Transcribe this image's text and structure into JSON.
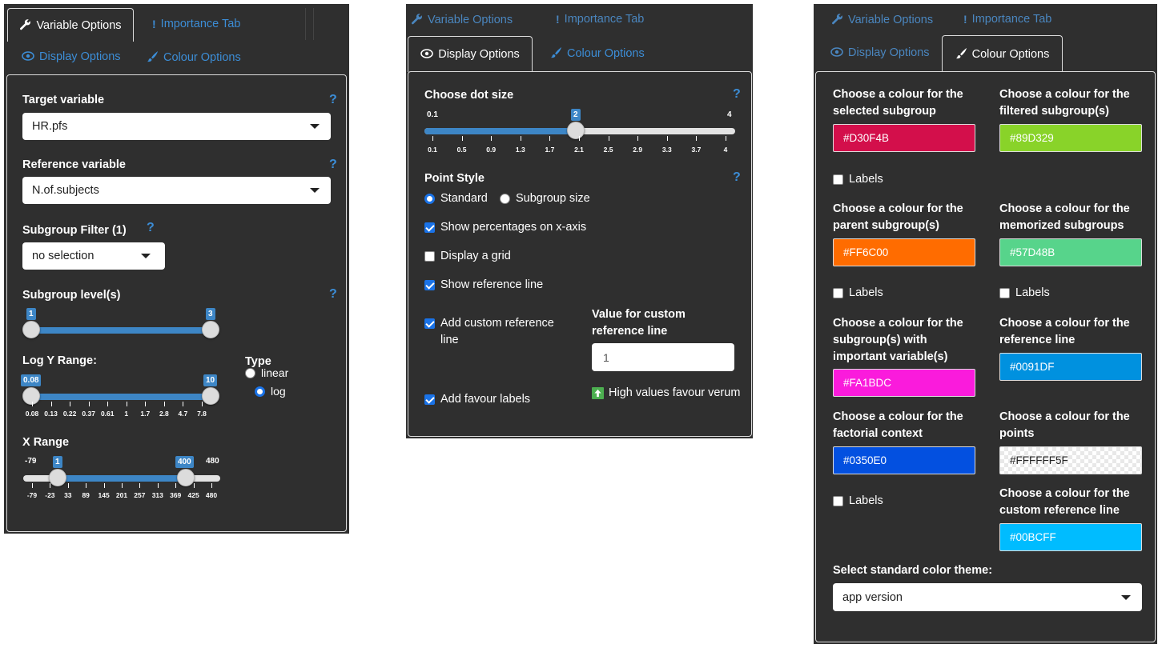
{
  "tabs": {
    "variable_options": "Variable Options",
    "importance_tab": "Importance Tab",
    "display_options": "Display Options",
    "colour_options": "Colour Options"
  },
  "panel1": {
    "target_variable": {
      "label": "Target variable",
      "value": "HR.pfs"
    },
    "reference_variable": {
      "label": "Reference variable",
      "value": "N.of.subjects"
    },
    "subgroup_filter": {
      "label": "Subgroup Filter (1)",
      "value": "no selection"
    },
    "subgroup_levels": {
      "label": "Subgroup level(s)",
      "min": "1",
      "max": "3"
    },
    "log_y_range": {
      "label": "Log Y Range:",
      "min": "0.08",
      "max": "10",
      "ticks": [
        "0.08",
        "0.13",
        "0.22",
        "0.37",
        "0.61",
        "1",
        "1.7",
        "2.8",
        "4.7",
        "7.8"
      ]
    },
    "type": {
      "label": "Type",
      "options": [
        "linear",
        "log"
      ],
      "selected": "log"
    },
    "x_range": {
      "label": "X Range",
      "edge_min": "-79",
      "edge_max": "480",
      "min": "1",
      "max": "400",
      "ticks": [
        "-79",
        "-23",
        "33",
        "89",
        "145",
        "201",
        "257",
        "313",
        "369",
        "425",
        "480"
      ]
    },
    "help": "?"
  },
  "panel2": {
    "dot_size": {
      "label": "Choose dot size",
      "edge_min": "0.1",
      "edge_max": "4",
      "value": "2",
      "ticks": [
        "0.1",
        "0.5",
        "0.9",
        "1.3",
        "1.7",
        "2.1",
        "2.5",
        "2.9",
        "3.3",
        "3.7",
        "4"
      ]
    },
    "point_style": {
      "label": "Point Style",
      "options": [
        "Standard",
        "Subgroup size"
      ],
      "selected": "Standard"
    },
    "show_percentages": "Show percentages on x-axis",
    "display_grid": "Display a grid",
    "show_reference_line": "Show reference line",
    "add_custom_reference": "Add custom reference",
    "add_custom_reference_2": "line",
    "custom_value_label_1": "Value for custom",
    "custom_value_label_2": "reference line",
    "custom_value": "1",
    "add_favour_labels": "Add favour labels",
    "favour_text": "High values favour verum",
    "help": "?"
  },
  "panel3": {
    "selected_subgroup": {
      "label1": "Choose a colour for the",
      "label2": "selected subgroup",
      "hex": "#D30F4B",
      "color": "#D30F4B"
    },
    "filtered_subgroup": {
      "label1": "Choose a colour for the",
      "label2": "filtered subgroup(s)",
      "hex": "#89D329",
      "color": "#89D329"
    },
    "parent_subgroup": {
      "label1": "Choose a colour for the",
      "label2": "parent subgroup(s)",
      "hex": "#FF6C00",
      "color": "#FF6C00"
    },
    "memorized_subgroups": {
      "label1": "Choose a colour for the",
      "label2": "memorized subgroups",
      "hex": "#57D48B",
      "color": "#57D48B"
    },
    "important_variable": {
      "label1": "Choose a colour for the",
      "label2": "subgroup(s) with",
      "label3": "important variable(s)",
      "hex": "#FA1BDC",
      "color": "#FA1BDC"
    },
    "reference_line": {
      "label1": "Choose a colour for the",
      "label2": "reference line",
      "hex": "#0091DF",
      "color": "#0091DF"
    },
    "factorial_context": {
      "label1": "Choose a colour for the",
      "label2": "factorial context",
      "hex": "#0350E0",
      "color": "#0350E0"
    },
    "points": {
      "label1": "Choose a colour for the",
      "label2": "points",
      "hex": "#FFFFFF5F",
      "color": "#FFFFFF"
    },
    "custom_reference_line": {
      "label1": "Choose a colour for the",
      "label2": "custom reference line",
      "hex": "#00BCFF",
      "color": "#00BCFF"
    },
    "labels": "Labels",
    "theme_label": "Select standard color theme:",
    "theme_value": "app version"
  }
}
